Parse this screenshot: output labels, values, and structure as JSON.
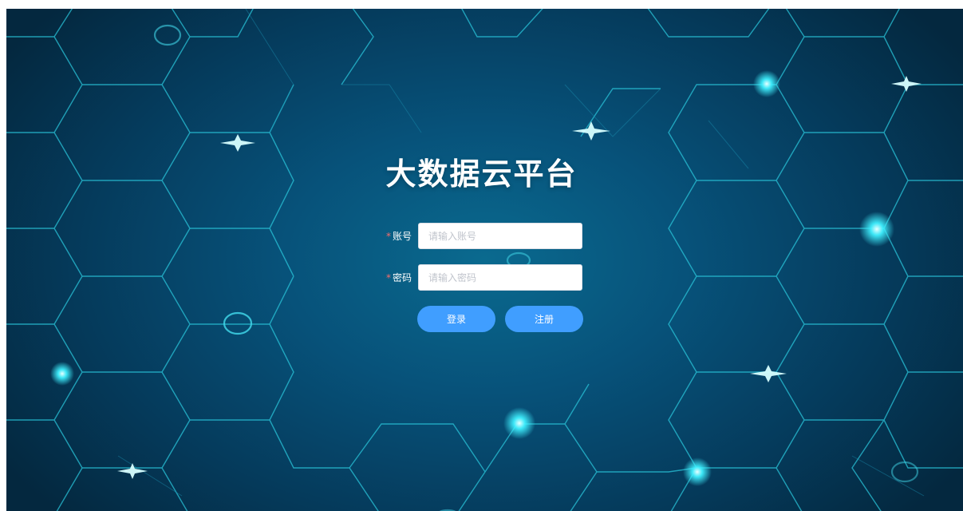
{
  "header": {
    "title": "大数据云平台"
  },
  "form": {
    "account": {
      "required_mark": "*",
      "label": "账号",
      "value": "",
      "placeholder": "请输入账号"
    },
    "password": {
      "required_mark": "*",
      "label": "密码",
      "value": "",
      "placeholder": "请输入密码"
    }
  },
  "actions": {
    "login_label": "登录",
    "register_label": "注册"
  },
  "colors": {
    "primary_button": "#409eff",
    "required_mark": "#f56c6c",
    "background_dark": "#04283f",
    "background_center": "#0a6a8f",
    "hex_lines": "#29c3d8",
    "glow": "#3ff0ff"
  }
}
